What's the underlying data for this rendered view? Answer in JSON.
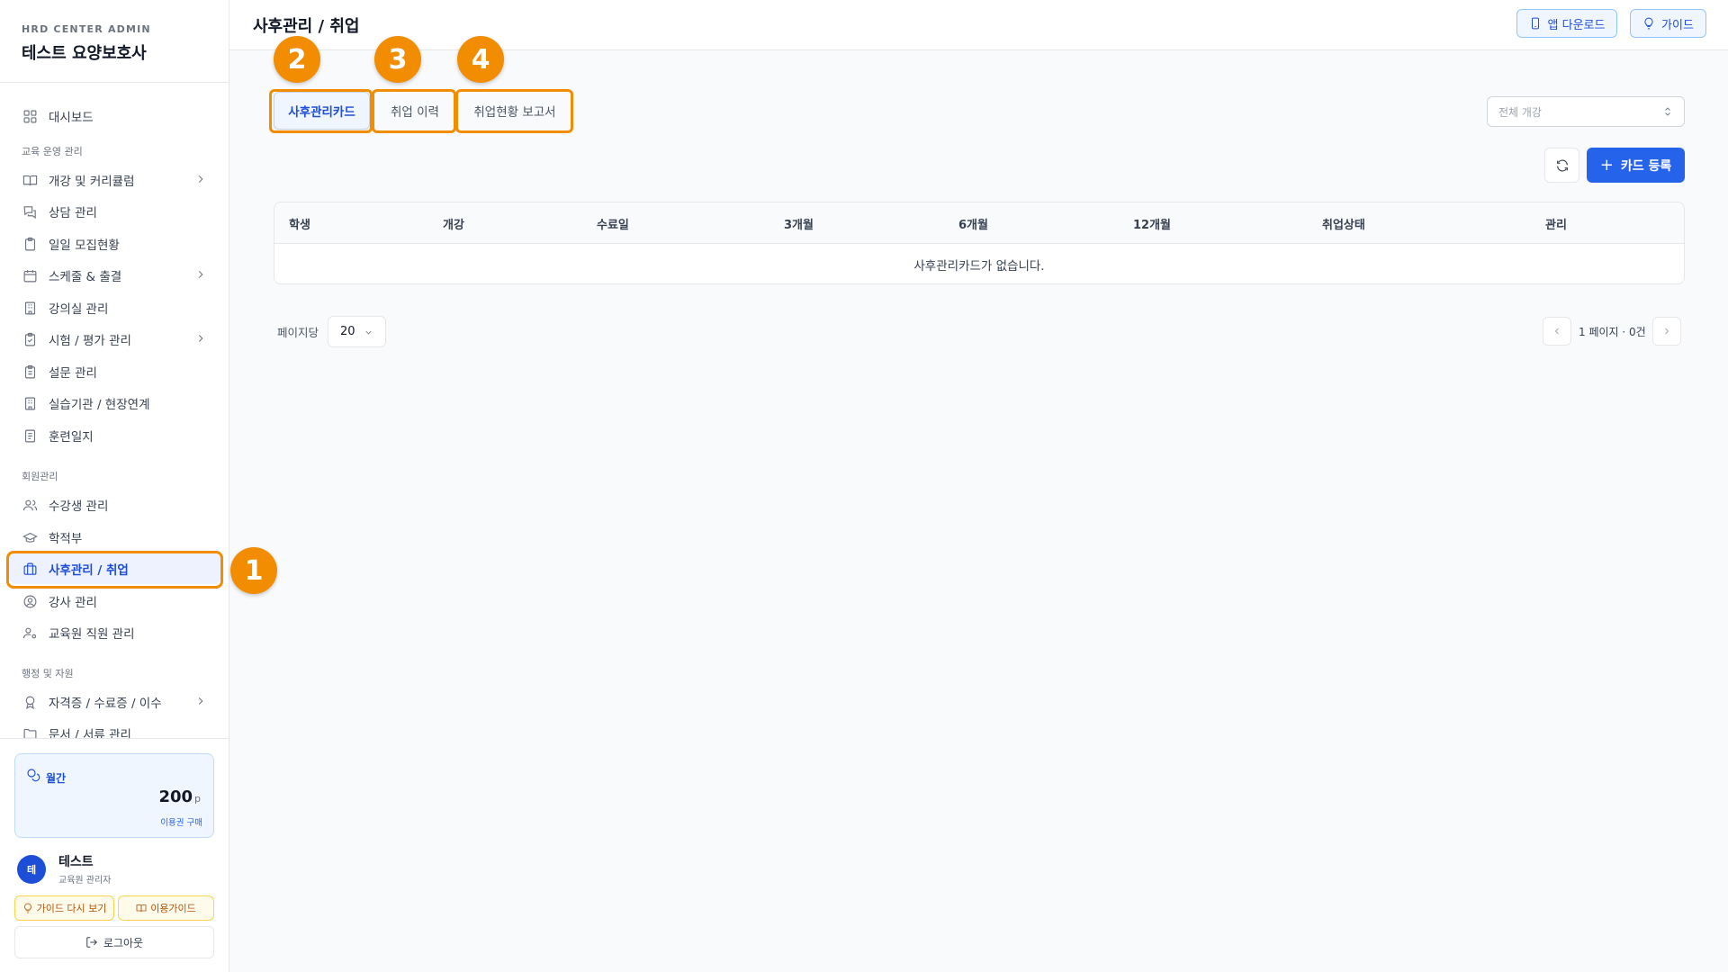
{
  "brand": {
    "subtitle": "HRD CENTER ADMIN",
    "title": "테스트 요양보호사"
  },
  "sidebar": {
    "dashboard": "대시보드",
    "section_education": "교육 운영 관리",
    "curriculum": "개강 및 커리큘럼",
    "consult": "상담 관리",
    "daily_recruit": "일일 모집현황",
    "schedule": "스케줄 & 출결",
    "classroom": "강의실 관리",
    "exam": "시험 / 평가 관리",
    "survey": "설문 관리",
    "practice": "실습기관 / 현장연계",
    "journal": "훈련일지",
    "section_members": "회원관리",
    "students": "수강생 관리",
    "registry": "학적부",
    "aftercare": "사후관리 / 취업",
    "instructors": "강사 관리",
    "staff": "교육원 직원 관리",
    "section_admin": "행정 및 자원",
    "certificates": "자격증 / 수료증 / 이수",
    "documents": "문서 / 서류 관리"
  },
  "points": {
    "label": "월간",
    "value": "200",
    "unit": "p",
    "buy": "이용권 구매"
  },
  "user": {
    "avatar": "테",
    "name": "테스트",
    "role": "교육원 관리자"
  },
  "buttons": {
    "guide_again": "가이드 다시 보기",
    "usage_guide": "이용가이드",
    "logout": "로그아웃"
  },
  "header": {
    "title": "사후관리 / 취업",
    "app_download": "앱 다운로드",
    "guide": "가이드"
  },
  "tabs": [
    "사후관리카드",
    "취업 이력",
    "취업현황 보고서"
  ],
  "badges": [
    "1",
    "2",
    "3",
    "4"
  ],
  "filter": {
    "placeholder": "전체 개강"
  },
  "actions": {
    "add_card": "카드 등록"
  },
  "table": {
    "columns": [
      "학생",
      "개강",
      "수료일",
      "3개월",
      "6개월",
      "12개월",
      "취업상태",
      "관리"
    ],
    "empty": "사후관리카드가 없습니다."
  },
  "pagination": {
    "per_page_label": "페이지당",
    "per_page": "20",
    "info": "1 페이지 · 0건"
  },
  "colors": {
    "accent": "#2563eb",
    "highlight": "#f28c00"
  }
}
